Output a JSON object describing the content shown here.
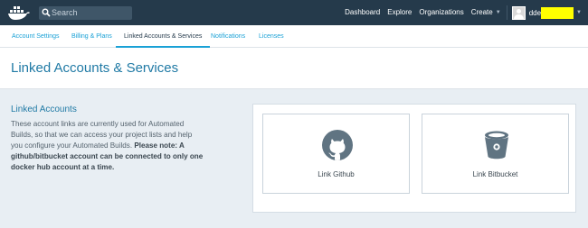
{
  "topbar": {
    "search_placeholder": "Search",
    "links": {
      "dashboard": "Dashboard",
      "explore": "Explore",
      "organizations": "Organizations",
      "create": "Create"
    },
    "username": "dde",
    "brand_color": "#253a4b"
  },
  "tabs": {
    "account_settings": "Account Settings",
    "billing": "Billing & Plans",
    "linked": "Linked Accounts & Services",
    "notifications": "Notifications",
    "licenses": "Licenses",
    "active": "Linked Accounts & Services"
  },
  "page": {
    "title": "Linked Accounts & Services"
  },
  "linked_accounts": {
    "heading": "Linked Accounts",
    "description": "These account links are currently used for Automated Builds, so that we can access your project lists and help you configure your Automated Builds.",
    "note": "Please note: A github/bitbucket account can be connected to only one docker hub account at a time.",
    "github_label": "Link Github",
    "bitbucket_label": "Link Bitbucket",
    "icon_color": "#607482"
  },
  "icons": {
    "logo": "docker-whale-icon",
    "search": "search-icon",
    "github": "github-octocat-icon",
    "bitbucket": "bitbucket-bucket-icon",
    "avatar": "user-avatar-icon"
  }
}
